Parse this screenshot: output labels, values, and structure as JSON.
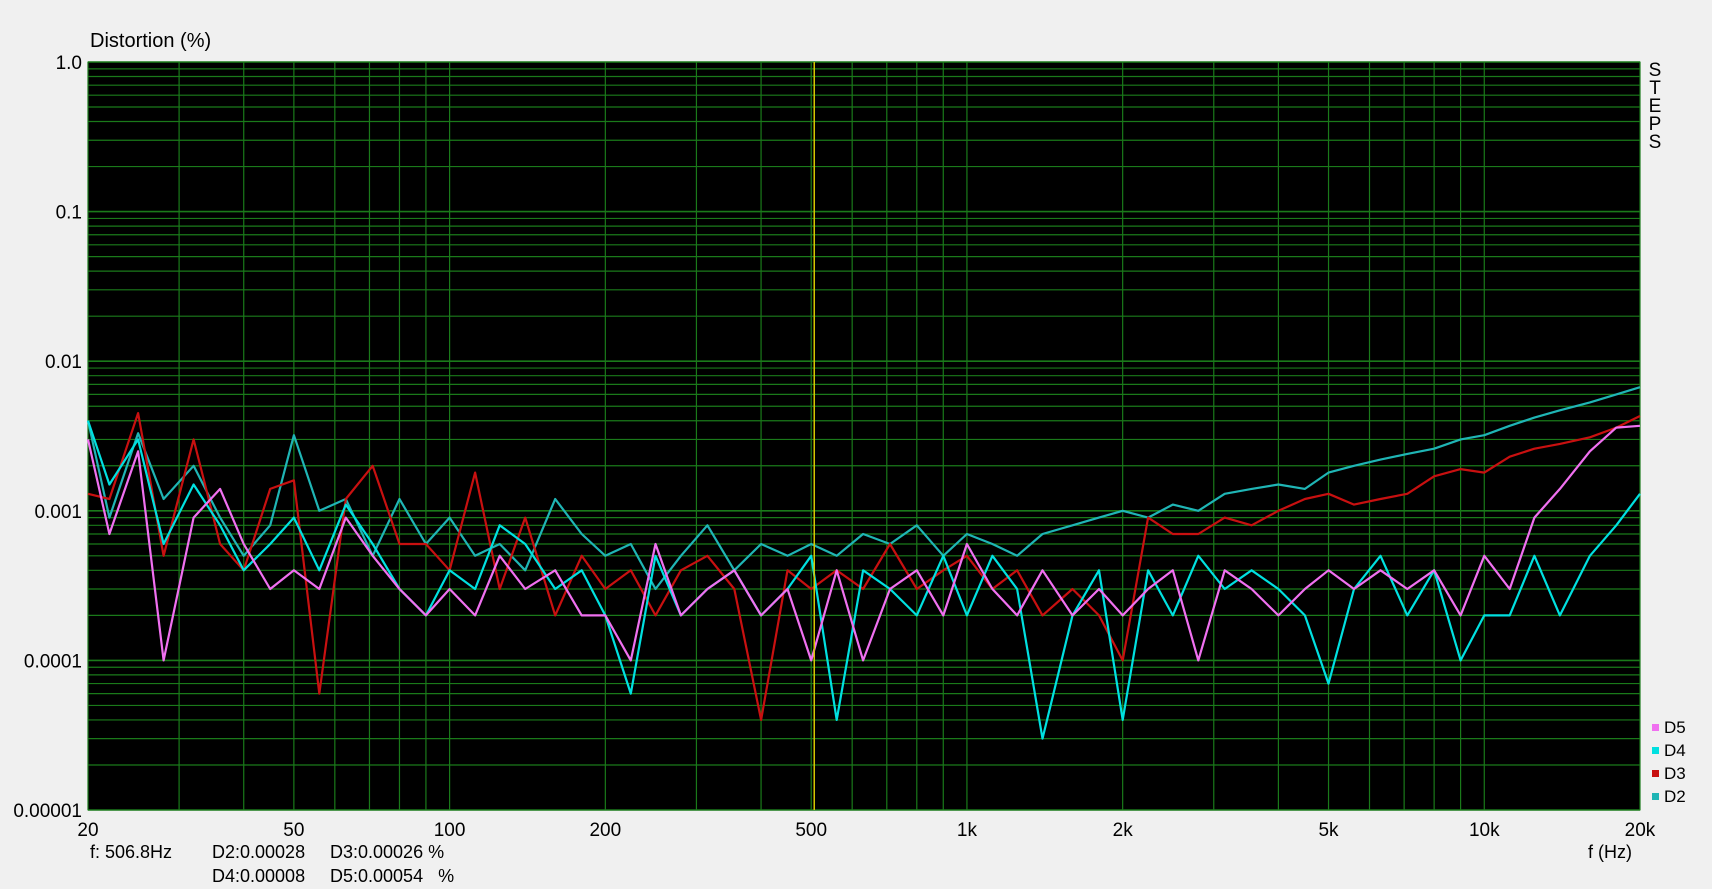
{
  "chart_data": {
    "type": "line",
    "ylabel": "Distortion (%)",
    "xlabel": "f (Hz)",
    "xscale": "log",
    "yscale": "log",
    "xlim": [
      20,
      20000
    ],
    "ylim": [
      1e-05,
      1.0
    ],
    "grid": true,
    "legend_position": "bottom-right",
    "x_ticks": [
      {
        "value": 20,
        "label": "20"
      },
      {
        "value": 50,
        "label": "50"
      },
      {
        "value": 100,
        "label": "100"
      },
      {
        "value": 200,
        "label": "200"
      },
      {
        "value": 500,
        "label": "500"
      },
      {
        "value": 1000,
        "label": "1k"
      },
      {
        "value": 2000,
        "label": "2k"
      },
      {
        "value": 5000,
        "label": "5k"
      },
      {
        "value": 10000,
        "label": "10k"
      },
      {
        "value": 20000,
        "label": "20k"
      }
    ],
    "y_ticks": [
      {
        "value": 1.0,
        "label": "1.0"
      },
      {
        "value": 0.1,
        "label": "0.1"
      },
      {
        "value": 0.01,
        "label": "0.01"
      },
      {
        "value": 0.001,
        "label": "0.001"
      },
      {
        "value": 0.0001,
        "label": "0.0001"
      },
      {
        "value": 1e-05,
        "label": "0.00001"
      }
    ],
    "cursor_x": 506.8,
    "side_label": [
      "S",
      "T",
      "E",
      "P",
      "S"
    ],
    "series": [
      {
        "name": "D2",
        "color": "#1fb5b5",
        "x": [
          20,
          22,
          25,
          28,
          32,
          36,
          40,
          45,
          50,
          56,
          63,
          71,
          80,
          90,
          100,
          112,
          125,
          140,
          160,
          180,
          200,
          224,
          250,
          280,
          315,
          355,
          400,
          450,
          500,
          560,
          630,
          710,
          800,
          900,
          1000,
          1120,
          1250,
          1400,
          1600,
          1800,
          2000,
          2240,
          2500,
          2800,
          3150,
          3550,
          4000,
          4500,
          5000,
          5600,
          6300,
          7100,
          8000,
          9000,
          10000,
          11200,
          12500,
          14000,
          16000,
          18000,
          20000
        ],
        "values": [
          0.004,
          0.0009,
          0.0033,
          0.0012,
          0.002,
          0.0009,
          0.0005,
          0.0008,
          0.0032,
          0.001,
          0.0012,
          0.0005,
          0.0012,
          0.0006,
          0.0009,
          0.0005,
          0.0006,
          0.0004,
          0.0012,
          0.0007,
          0.0005,
          0.0006,
          0.0003,
          0.0005,
          0.0008,
          0.0004,
          0.0006,
          0.0005,
          0.0006,
          0.0005,
          0.0007,
          0.0006,
          0.0008,
          0.0005,
          0.0007,
          0.0006,
          0.0005,
          0.0007,
          0.0008,
          0.0009,
          0.001,
          0.0009,
          0.0011,
          0.001,
          0.0013,
          0.0014,
          0.0015,
          0.0014,
          0.0018,
          0.002,
          0.0022,
          0.0024,
          0.0026,
          0.003,
          0.0032,
          0.0037,
          0.0042,
          0.0047,
          0.0053,
          0.006,
          0.0067
        ]
      },
      {
        "name": "D3",
        "color": "#c81010",
        "x": [
          20,
          22,
          25,
          28,
          32,
          36,
          40,
          45,
          50,
          56,
          63,
          71,
          80,
          90,
          100,
          112,
          125,
          140,
          160,
          180,
          200,
          224,
          250,
          280,
          315,
          355,
          400,
          450,
          500,
          560,
          630,
          710,
          800,
          900,
          1000,
          1120,
          1250,
          1400,
          1600,
          1800,
          2000,
          2240,
          2500,
          2800,
          3150,
          3550,
          4000,
          4500,
          5000,
          5600,
          6300,
          7100,
          8000,
          9000,
          10000,
          11200,
          12500,
          14000,
          16000,
          18000,
          20000
        ],
        "values": [
          0.0013,
          0.0012,
          0.0045,
          0.0005,
          0.003,
          0.0006,
          0.0004,
          0.0014,
          0.0016,
          6e-05,
          0.0012,
          0.002,
          0.0006,
          0.0006,
          0.0004,
          0.0018,
          0.0003,
          0.0009,
          0.0002,
          0.0005,
          0.0003,
          0.0004,
          0.0002,
          0.0004,
          0.0005,
          0.0003,
          4e-05,
          0.0004,
          0.0003,
          0.0004,
          0.0003,
          0.0006,
          0.0003,
          0.0004,
          0.0005,
          0.0003,
          0.0004,
          0.0002,
          0.0003,
          0.0002,
          0.0001,
          0.0009,
          0.0007,
          0.0007,
          0.0009,
          0.0008,
          0.001,
          0.0012,
          0.0013,
          0.0011,
          0.0012,
          0.0013,
          0.0017,
          0.0019,
          0.0018,
          0.0023,
          0.0026,
          0.0028,
          0.0031,
          0.0036,
          0.0043
        ]
      },
      {
        "name": "D4",
        "color": "#00e0e0",
        "x": [
          20,
          22,
          25,
          28,
          32,
          36,
          40,
          45,
          50,
          56,
          63,
          71,
          80,
          90,
          100,
          112,
          125,
          140,
          160,
          180,
          200,
          224,
          250,
          280,
          315,
          355,
          400,
          450,
          500,
          560,
          630,
          710,
          800,
          900,
          1000,
          1120,
          1250,
          1400,
          1600,
          1800,
          2000,
          2240,
          2500,
          2800,
          3150,
          3550,
          4000,
          4500,
          5000,
          5600,
          6300,
          7100,
          8000,
          9000,
          10000,
          11200,
          12500,
          14000,
          16000,
          18000,
          20000
        ],
        "values": [
          0.004,
          0.0015,
          0.003,
          0.0006,
          0.0015,
          0.0008,
          0.0004,
          0.0006,
          0.0009,
          0.0004,
          0.0011,
          0.0006,
          0.0003,
          0.0002,
          0.0004,
          0.0003,
          0.0008,
          0.0006,
          0.0003,
          0.0004,
          0.0002,
          6e-05,
          0.0005,
          0.0002,
          0.0003,
          0.0004,
          0.0002,
          0.0003,
          0.0005,
          4e-05,
          0.0004,
          0.0003,
          0.0002,
          0.0005,
          0.0002,
          0.0005,
          0.0003,
          3e-05,
          0.0002,
          0.0004,
          4e-05,
          0.0004,
          0.0002,
          0.0005,
          0.0003,
          0.0004,
          0.0003,
          0.0002,
          7e-05,
          0.0003,
          0.0005,
          0.0002,
          0.0004,
          0.0001,
          0.0002,
          0.0002,
          0.0005,
          0.0002,
          0.0005,
          0.0008,
          0.0013
        ]
      },
      {
        "name": "D5",
        "color": "#f070f0",
        "x": [
          20,
          22,
          25,
          28,
          32,
          36,
          40,
          45,
          50,
          56,
          63,
          71,
          80,
          90,
          100,
          112,
          125,
          140,
          160,
          180,
          200,
          224,
          250,
          280,
          315,
          355,
          400,
          450,
          500,
          560,
          630,
          710,
          800,
          900,
          1000,
          1120,
          1250,
          1400,
          1600,
          1800,
          2000,
          2240,
          2500,
          2800,
          3150,
          3550,
          4000,
          4500,
          5000,
          5600,
          6300,
          7100,
          8000,
          9000,
          10000,
          11200,
          12500,
          14000,
          16000,
          18000,
          20000
        ],
        "values": [
          0.003,
          0.0007,
          0.0025,
          0.0001,
          0.0009,
          0.0014,
          0.0006,
          0.0003,
          0.0004,
          0.0003,
          0.0009,
          0.0005,
          0.0003,
          0.0002,
          0.0003,
          0.0002,
          0.0005,
          0.0003,
          0.0004,
          0.0002,
          0.0002,
          0.0001,
          0.0006,
          0.0002,
          0.0003,
          0.0004,
          0.0002,
          0.0003,
          0.0001,
          0.0004,
          0.0001,
          0.0003,
          0.0004,
          0.0002,
          0.0006,
          0.0003,
          0.0002,
          0.0004,
          0.0002,
          0.0003,
          0.0002,
          0.0003,
          0.0004,
          0.0001,
          0.0004,
          0.0003,
          0.0002,
          0.0003,
          0.0004,
          0.0003,
          0.0004,
          0.0003,
          0.0004,
          0.0002,
          0.0005,
          0.0003,
          0.0009,
          0.0014,
          0.0025,
          0.0036,
          0.0037
        ]
      }
    ]
  },
  "readout": {
    "freq": "f: 506.8Hz",
    "d2": "D2:0.00028",
    "d3": "D3:0.00026 %",
    "d4": "D4:0.00008",
    "d5": "D5:0.00054   %"
  },
  "legend": [
    {
      "name": "D5",
      "color": "#f070f0"
    },
    {
      "name": "D4",
      "color": "#00e0e0"
    },
    {
      "name": "D3",
      "color": "#c81010"
    },
    {
      "name": "D2",
      "color": "#1fb5b5"
    }
  ]
}
